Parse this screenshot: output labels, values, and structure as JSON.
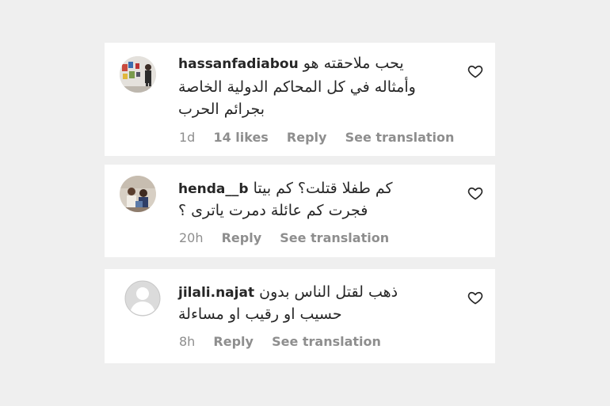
{
  "comments": [
    {
      "username": "hassanfadiabou",
      "lines": [
        "يحب ملاحقته هو",
        "وأمثاله في كل المحاكم الدولية الخاصة",
        "بجرائم الحرب"
      ],
      "time": "1d",
      "likes": "14 likes",
      "reply": "Reply",
      "translate": "See translation"
    },
    {
      "username": "henda__b",
      "lines": [
        "كم طفلا قتلت؟ كم بيتا",
        "فجرت كم عائلة دمرت ياترى ؟"
      ],
      "time": "20h",
      "reply": "Reply",
      "translate": "See translation"
    },
    {
      "username": "jilali.najat",
      "lines": [
        "ذهب لقتل الناس بدون",
        "حسيب او رقيب او مساءلة"
      ],
      "time": "8h",
      "reply": "Reply",
      "translate": "See translation"
    }
  ],
  "icons": {
    "like": "heart-icon",
    "avatar_default": "default-avatar-icon"
  },
  "colors": {
    "text": "#262626",
    "meta": "#8e8e8e",
    "background": "#efefef",
    "card": "#ffffff"
  }
}
